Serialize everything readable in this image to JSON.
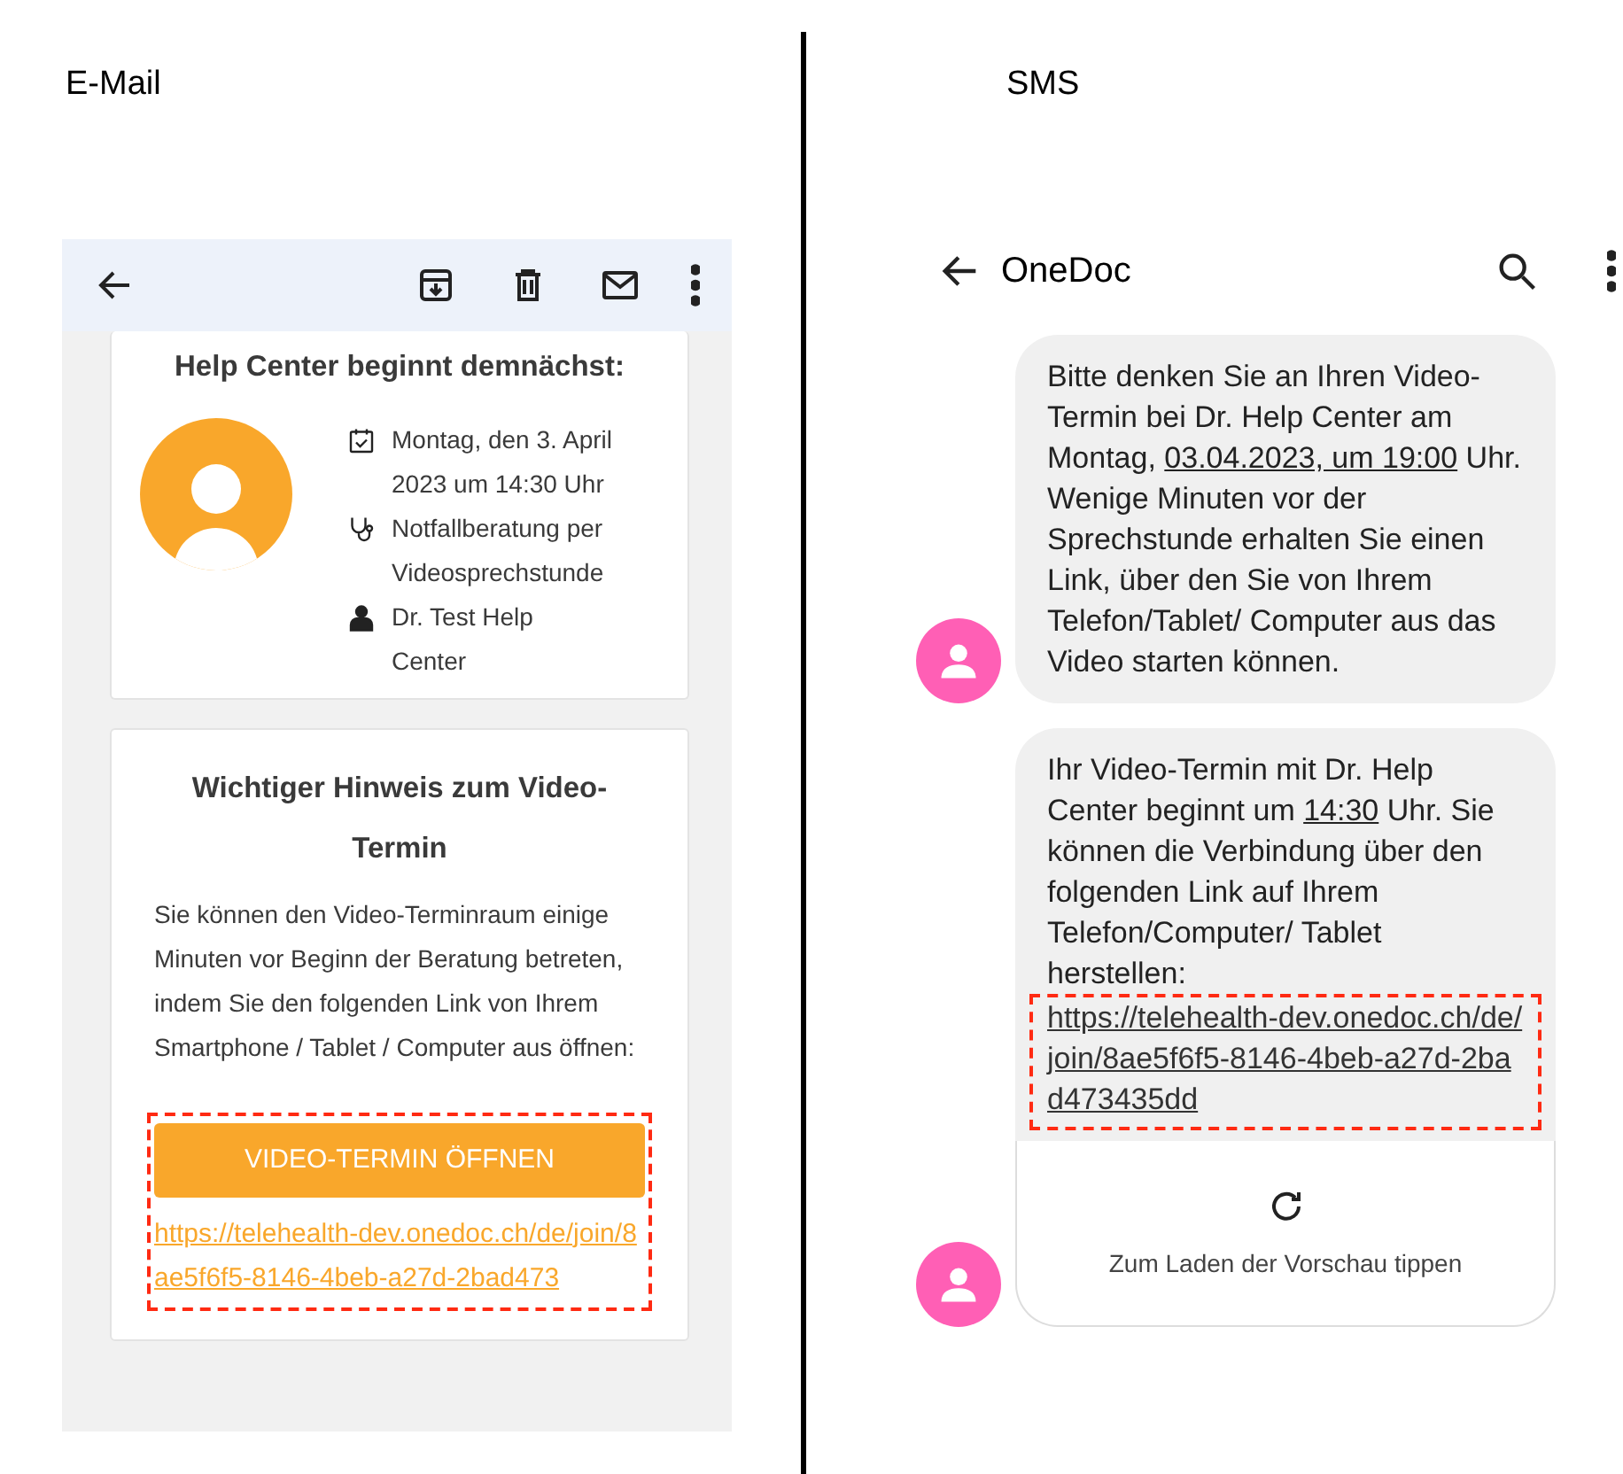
{
  "email": {
    "heading": "E-Mail",
    "appointment_card": {
      "title": "Help Center beginnt demnächst:",
      "details": [
        {
          "kind": "calendar",
          "text": "Montag, den 3. April 2023 um 14:30 Uhr"
        },
        {
          "kind": "stethoscope",
          "text": "Notfallberatung per Videosprechstunde"
        },
        {
          "kind": "doctor",
          "text": "Dr. Test Help Center"
        }
      ]
    },
    "notice_card": {
      "title": "Wichtiger Hinweis zum Video-Termin",
      "body": "Sie können den Video-Terminraum einige Minuten vor Beginn der Beratung betreten, indem Sie den folgenden Link von Ihrem Smartphone / Tablet / Computer aus öffnen:",
      "highlighted": true,
      "button": "VIDEO-TERMIN ÖFFNEN",
      "link": "https://telehealth-dev.onedoc.ch/de/join/8ae5f6f5-8146-4beb-a27d-2bad473"
    }
  },
  "sms": {
    "heading": "SMS",
    "header": {
      "title": "OneDoc"
    },
    "messages": [
      {
        "segments": [
          {
            "text": "Bitte denken Sie an Ihren Video-Termin bei Dr. Help Center am Montag, ",
            "underline": false
          },
          {
            "text": "03.04.2023, um 19:00",
            "underline": true
          },
          {
            "text": " Uhr. Wenige Minuten vor der Sprechstunde erhalten Sie einen Link, über den Sie von Ihrem Telefon/Tablet/ Computer aus das Video starten können.",
            "underline": false
          }
        ]
      },
      {
        "segments": [
          {
            "text": "Ihr Video-Termin mit Dr. Help Center beginnt um ",
            "underline": false
          },
          {
            "text": "14:30",
            "underline": true
          },
          {
            "text": " Uhr. Sie können die Verbindung über den folgenden Link auf Ihrem Telefon/Computer/ Tablet herstellen:",
            "underline": false
          }
        ],
        "link": "https://telehealth-dev.onedoc.ch/de/join/8ae5f6f5-8146-4beb-a27d-2bad473435dd",
        "highlighted": true,
        "preview": "Zum Laden der Vorschau tippen"
      }
    ]
  }
}
